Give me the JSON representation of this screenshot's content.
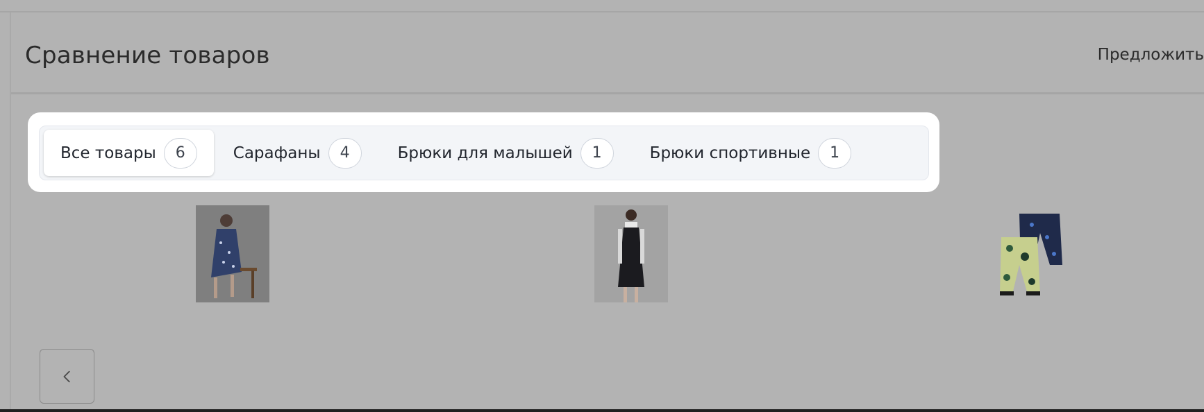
{
  "header": {
    "title": "Сравнение товаров",
    "suggest_label": "Предложить"
  },
  "tabs": [
    {
      "label": "Все товары",
      "count": "6",
      "active": true
    },
    {
      "label": "Сарафаны",
      "count": "4",
      "active": false
    },
    {
      "label": "Брюки для малышей",
      "count": "1",
      "active": false
    },
    {
      "label": "Брюки спортивные",
      "count": "1",
      "active": false
    }
  ],
  "products": [
    {
      "icon": "dress-floral-photo"
    },
    {
      "icon": "black-sundress-photo"
    },
    {
      "icon": "kids-pants-photo"
    }
  ],
  "navigation": {
    "prev_icon": "chevron-left-icon"
  },
  "colors": {
    "overlay": "#b3b3b3",
    "tabs_background": "#f3f5f8",
    "active_tab": "#ffffff",
    "text": "#22262e"
  }
}
